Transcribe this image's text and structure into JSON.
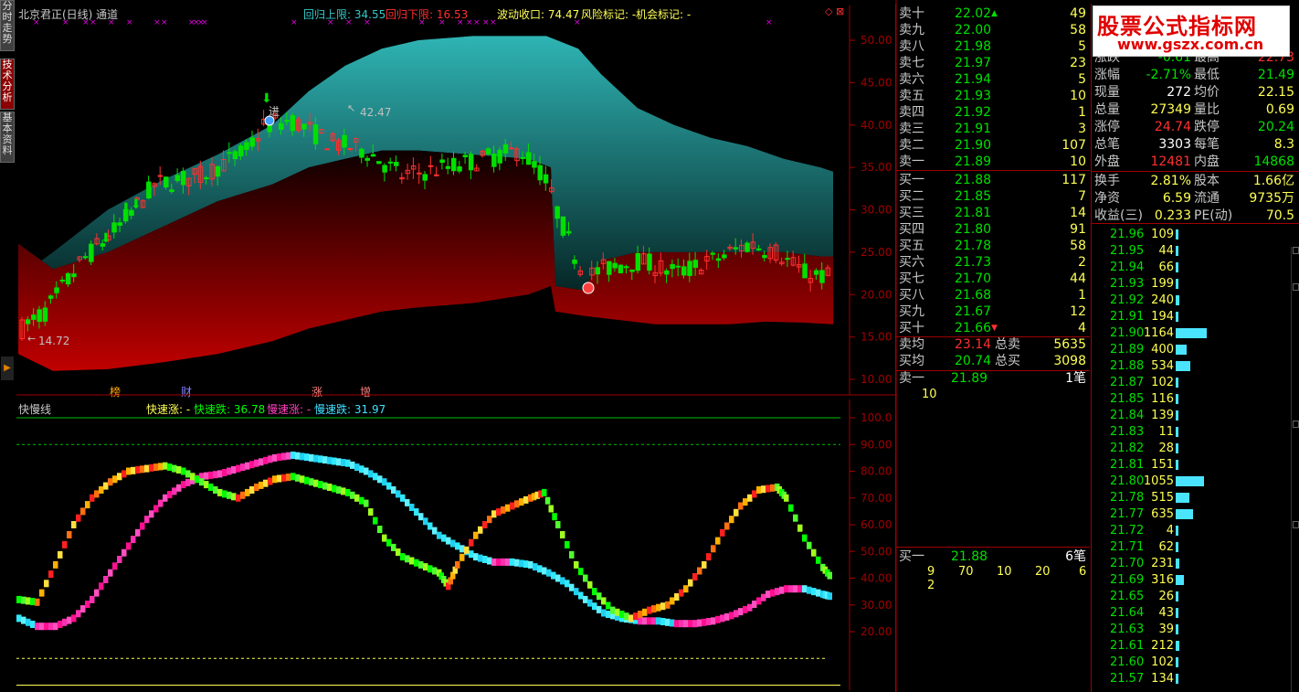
{
  "left_tabs": [
    {
      "label": "分时走势"
    },
    {
      "label": "技术分析",
      "active": true
    },
    {
      "label": "基本资料"
    }
  ],
  "main_chart": {
    "title": "北京君正(日线) 通道",
    "legend": [
      {
        "text": "回归上限: 34.55",
        "color": "#34c8c8"
      },
      {
        "text": "回归下限: 16.53",
        "color": "#ff3030"
      },
      {
        "text": "波动收口: 74.47",
        "color": "#ffff54"
      },
      {
        "text": "风险标记: -",
        "color": "#ffff54"
      },
      {
        "text": "机会标记: -",
        "color": "#ffff54"
      }
    ],
    "y_ticks": [
      "50.00",
      "45.00",
      "40.00",
      "35.00",
      "30.00",
      "25.00",
      "20.00",
      "15.00",
      "10.00"
    ],
    "high_label": "42.47",
    "low_label": "14.72",
    "markers": [
      {
        "text": "榜",
        "color": "#ffa500"
      },
      {
        "text": "财",
        "color": "#8080ff"
      },
      {
        "text": "涨",
        "color": "#ff8080"
      },
      {
        "text": "增",
        "color": "#ff8080"
      }
    ],
    "buy_mark_label": "进"
  },
  "sub_chart": {
    "title": "快慢线",
    "legend": [
      {
        "text": "快速涨: -",
        "color": "#ffff54"
      },
      {
        "text": "快速跌: 36.78",
        "color": "#00ff00"
      },
      {
        "text": "慢速涨: -",
        "color": "#ff40c0"
      },
      {
        "text": "慢速跌: 31.97",
        "color": "#40e0ff"
      }
    ],
    "y_ticks": [
      "100.0",
      "90.00",
      "80.00",
      "70.00",
      "60.00",
      "50.00",
      "40.00",
      "30.00",
      "20.00"
    ]
  },
  "order_book": {
    "sell": [
      {
        "label": "卖十",
        "price": "22.02",
        "vol": "49"
      },
      {
        "label": "卖九",
        "price": "22.00",
        "vol": "58"
      },
      {
        "label": "卖八",
        "price": "21.98",
        "vol": "5"
      },
      {
        "label": "卖七",
        "price": "21.97",
        "vol": "23"
      },
      {
        "label": "卖六",
        "price": "21.94",
        "vol": "5"
      },
      {
        "label": "卖五",
        "price": "21.93",
        "vol": "10"
      },
      {
        "label": "卖四",
        "price": "21.92",
        "vol": "1"
      },
      {
        "label": "卖三",
        "price": "21.91",
        "vol": "3"
      },
      {
        "label": "卖二",
        "price": "21.90",
        "vol": "107"
      },
      {
        "label": "卖一",
        "price": "21.89",
        "vol": "10"
      }
    ],
    "buy": [
      {
        "label": "买一",
        "price": "21.88",
        "vol": "117"
      },
      {
        "label": "买二",
        "price": "21.85",
        "vol": "7"
      },
      {
        "label": "买三",
        "price": "21.81",
        "vol": "14"
      },
      {
        "label": "买四",
        "price": "21.80",
        "vol": "91"
      },
      {
        "label": "买五",
        "price": "21.78",
        "vol": "58"
      },
      {
        "label": "买六",
        "price": "21.73",
        "vol": "2"
      },
      {
        "label": "买七",
        "price": "21.70",
        "vol": "44"
      },
      {
        "label": "买八",
        "price": "21.68",
        "vol": "1"
      },
      {
        "label": "买九",
        "price": "21.67",
        "vol": "12"
      },
      {
        "label": "买十",
        "price": "21.66",
        "vol": "4"
      }
    ],
    "avg_sell_label": "卖均",
    "avg_sell": "23.14",
    "total_sell_label": "总卖",
    "total_sell": "5635",
    "avg_buy_label": "买均",
    "avg_buy": "20.74",
    "total_buy_label": "总买",
    "total_buy": "3098",
    "queue_sell": {
      "label": "卖一",
      "price": "21.89",
      "count": "1笔",
      "orders": [
        "10"
      ]
    },
    "queue_buy": {
      "label": "买一",
      "price": "21.88",
      "count": "6笔",
      "orders": [
        "9",
        "70",
        "10",
        "20",
        "6",
        "2"
      ]
    }
  },
  "stats": [
    {
      "l1": "涨跌",
      "v1": "-0.61",
      "c1": "#00e000",
      "l2": "最高",
      "v2": "22.73",
      "c2": "#ff3030"
    },
    {
      "l1": "涨幅",
      "v1": "-2.71%",
      "c1": "#00e000",
      "l2": "最低",
      "v2": "21.49",
      "c2": "#00e000"
    },
    {
      "l1": "现量",
      "v1": "272",
      "c1": "#ffffff",
      "l2": "均价",
      "v2": "22.15",
      "c2": "#ffff54"
    },
    {
      "l1": "总量",
      "v1": "27349",
      "c1": "#ffff54",
      "l2": "量比",
      "v2": "0.69",
      "c2": "#ffff54"
    },
    {
      "l1": "涨停",
      "v1": "24.74",
      "c1": "#ff3030",
      "l2": "跌停",
      "v2": "20.24",
      "c2": "#00e000"
    },
    {
      "l1": "总笔",
      "v1": "3303",
      "c1": "#ffffff",
      "l2": "每笔",
      "v2": "8.3",
      "c2": "#ffff54"
    },
    {
      "l1": "外盘",
      "v1": "12481",
      "c1": "#ff3030",
      "l2": "内盘",
      "v2": "14868",
      "c2": "#00e000"
    },
    {
      "l1": "换手",
      "v1": "2.81%",
      "c1": "#ffff54",
      "l2": "股本",
      "v2": "1.66亿",
      "c2": "#ffff54"
    },
    {
      "l1": "净资",
      "v1": "6.59",
      "c1": "#ffff54",
      "l2": "流通",
      "v2": "9735万",
      "c2": "#ffff54"
    },
    {
      "l1": "收益(三)",
      "v1": "0.233",
      "c1": "#ffff54",
      "l2": "PE(动)",
      "v2": "70.5",
      "c2": "#ffff54"
    }
  ],
  "ticks": [
    {
      "price": "21.96",
      "vol": "109",
      "bar": 0.06
    },
    {
      "price": "21.95",
      "vol": "44",
      "bar": 0.03
    },
    {
      "price": "21.94",
      "vol": "66",
      "bar": 0.04
    },
    {
      "price": "21.93",
      "vol": "199",
      "bar": 0.1
    },
    {
      "price": "21.92",
      "vol": "240",
      "bar": 0.12
    },
    {
      "price": "21.91",
      "vol": "194",
      "bar": 0.1
    },
    {
      "price": "21.90",
      "vol": "1164",
      "bar": 1.0
    },
    {
      "price": "21.89",
      "vol": "400",
      "bar": 0.34
    },
    {
      "price": "21.88",
      "vol": "534",
      "bar": 0.46
    },
    {
      "price": "21.87",
      "vol": "102",
      "bar": 0.06
    },
    {
      "price": "21.85",
      "vol": "116",
      "bar": 0.07
    },
    {
      "price": "21.84",
      "vol": "139",
      "bar": 0.08
    },
    {
      "price": "21.83",
      "vol": "11",
      "bar": 0.02
    },
    {
      "price": "21.82",
      "vol": "28",
      "bar": 0.02
    },
    {
      "price": "21.81",
      "vol": "151",
      "bar": 0.08
    },
    {
      "price": "21.80",
      "vol": "1055",
      "bar": 0.9
    },
    {
      "price": "21.78",
      "vol": "515",
      "bar": 0.45
    },
    {
      "price": "21.77",
      "vol": "635",
      "bar": 0.55
    },
    {
      "price": "21.72",
      "vol": "4",
      "bar": 0.02
    },
    {
      "price": "21.71",
      "vol": "62",
      "bar": 0.04
    },
    {
      "price": "21.70",
      "vol": "231",
      "bar": 0.12
    },
    {
      "price": "21.69",
      "vol": "316",
      "bar": 0.27
    },
    {
      "price": "21.65",
      "vol": "26",
      "bar": 0.02
    },
    {
      "price": "21.64",
      "vol": "43",
      "bar": 0.03
    },
    {
      "price": "21.63",
      "vol": "39",
      "bar": 0.03
    },
    {
      "price": "21.61",
      "vol": "212",
      "bar": 0.12
    },
    {
      "price": "21.60",
      "vol": "102",
      "bar": 0.06
    },
    {
      "price": "21.57",
      "vol": "134",
      "bar": 0.07
    }
  ],
  "logo": {
    "title": "股票公式指标网",
    "url": "www.gszx.com.cn"
  }
}
